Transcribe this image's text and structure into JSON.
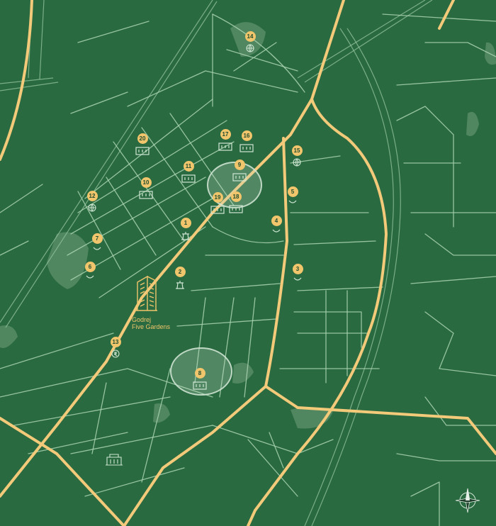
{
  "project": {
    "line1": "Godrej",
    "line2": "Five Gardens"
  },
  "colors": {
    "background": "#2a6a40",
    "major_road": "#f3c97a",
    "street": "#a9d3b0",
    "badge": "#f0c56b"
  },
  "markers": [
    {
      "id": "poi-1",
      "label": "1",
      "icon": "metro-station-icon"
    },
    {
      "id": "poi-2",
      "label": "2",
      "icon": "metro-station-icon"
    },
    {
      "id": "poi-3",
      "label": "3",
      "icon": "map-pin-icon"
    },
    {
      "id": "poi-4",
      "label": "4",
      "icon": "map-pin-icon"
    },
    {
      "id": "poi-5",
      "label": "5",
      "icon": "map-pin-icon"
    },
    {
      "id": "poi-6",
      "label": "6",
      "icon": "map-pin-icon"
    },
    {
      "id": "poi-7",
      "label": "7",
      "icon": "map-pin-icon"
    },
    {
      "id": "poi-8",
      "label": "8",
      "icon": "building-icon"
    },
    {
      "id": "poi-9",
      "label": "9",
      "icon": "building-icon"
    },
    {
      "id": "poi-10",
      "label": "10",
      "icon": "building-icon"
    },
    {
      "id": "poi-11",
      "label": "11",
      "icon": "building-icon"
    },
    {
      "id": "poi-12",
      "label": "12",
      "icon": "globe-icon"
    },
    {
      "id": "poi-13",
      "label": "13",
      "icon": "rupee-icon"
    },
    {
      "id": "poi-14",
      "label": "14",
      "icon": "globe-icon"
    },
    {
      "id": "poi-15",
      "label": "15",
      "icon": "globe-icon"
    },
    {
      "id": "poi-16",
      "label": "16",
      "icon": "building-icon"
    },
    {
      "id": "poi-17",
      "label": "17",
      "icon": "building-icon"
    },
    {
      "id": "poi-18",
      "label": "18",
      "icon": "building-icon"
    },
    {
      "id": "poi-19",
      "label": "19",
      "icon": "building-icon"
    },
    {
      "id": "poi-20",
      "label": "20",
      "icon": "building-icon"
    }
  ]
}
